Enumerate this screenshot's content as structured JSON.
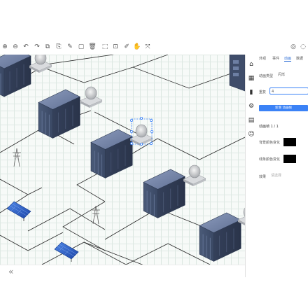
{
  "toolbar": {
    "tools": [
      {
        "icon": "zoom-in-icon",
        "glyph": "⊕"
      },
      {
        "icon": "zoom-out-icon",
        "glyph": "⊖"
      },
      {
        "icon": "undo-icon",
        "glyph": "↶"
      },
      {
        "icon": "redo-icon",
        "glyph": "↷"
      },
      {
        "icon": "copy-icon",
        "glyph": "⧉"
      },
      {
        "icon": "paint-icon",
        "glyph": "⎘"
      },
      {
        "icon": "pen-icon",
        "glyph": "✎"
      },
      {
        "icon": "frame-icon",
        "glyph": "▢"
      },
      {
        "icon": "delete-icon",
        "glyph": "🗑"
      },
      {
        "icon": "select-icon",
        "glyph": "⬚"
      },
      {
        "icon": "lock-icon",
        "glyph": "⊡"
      },
      {
        "icon": "brush-icon",
        "glyph": "✐"
      },
      {
        "icon": "hand-icon",
        "glyph": "✋"
      },
      {
        "icon": "fit-icon",
        "glyph": "⤧"
      }
    ],
    "right_icons": [
      {
        "icon": "view-icon",
        "glyph": "◎"
      },
      {
        "icon": "settings-icon",
        "glyph": "◌"
      }
    ]
  },
  "canvas_footer": {
    "left": "«",
    "right": "»"
  },
  "icon_bar": [
    {
      "icon": "home-icon",
      "glyph": "⌂"
    },
    {
      "icon": "grid-icon",
      "glyph": "▦"
    },
    {
      "icon": "chart-icon",
      "glyph": "▮"
    },
    {
      "icon": "gear-icon",
      "glyph": "⚙"
    },
    {
      "icon": "document-icon",
      "glyph": "▤"
    },
    {
      "icon": "user-icon",
      "glyph": "☺"
    }
  ],
  "panel": {
    "tabs": [
      "外观",
      "事件",
      "动画",
      "数据"
    ],
    "active_tab": 2,
    "anim_type_label": "动画类型",
    "anim_type_value": "闪烁",
    "repeat_label": "重复",
    "repeat_value": "4",
    "add_button": "新增 动画帧",
    "frame_title": "动画帧 1 / 1",
    "bg_color_label": "背景颜色变化",
    "border_color_label": "线条颜色变化",
    "bg_color": "#000000",
    "border_color": "#000000",
    "effect_label": "效果",
    "effect_placeholder": "请选择"
  },
  "colors": {
    "accent": "#3b82f6",
    "grid": "#dfe9e4",
    "transformer": "#4c5c78",
    "solar": "#2f5fc4"
  }
}
